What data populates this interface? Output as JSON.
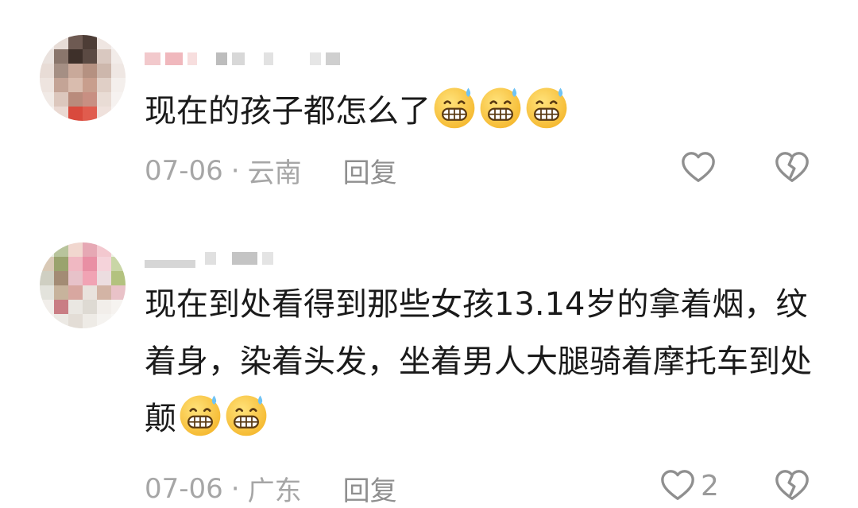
{
  "comments": [
    {
      "text": "现在的孩子都怎么了",
      "emoji_count": 3,
      "emoji_icon": "grimacing-sweat-emoji",
      "date": "07-06",
      "separator": "·",
      "location": "云南",
      "reply_label": "回复",
      "like_count": ""
    },
    {
      "text": "现在到处看得到那些女孩13.14岁的拿着烟，纹着身，染着头发，坐着男人大腿骑着摩托车到处颠",
      "emoji_count": 2,
      "emoji_icon": "grimacing-sweat-emoji",
      "date": "07-06",
      "separator": "·",
      "location": "广东",
      "reply_label": "回复",
      "like_count": "2"
    }
  ],
  "colors": {
    "text": "#1a1a1a",
    "meta": "#a6a6a6",
    "icon": "#8f8f8f"
  }
}
